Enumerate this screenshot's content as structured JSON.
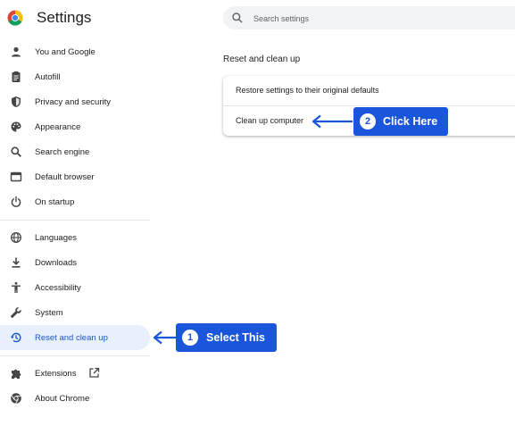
{
  "app": {
    "title": "Settings",
    "logo_icon": "chrome-logo-icon"
  },
  "search": {
    "placeholder": "Search settings",
    "icon": "search-icon"
  },
  "sidebar": {
    "items": [
      {
        "label": "You and Google",
        "icon": "person-icon"
      },
      {
        "label": "Autofill",
        "icon": "clipboard-icon"
      },
      {
        "label": "Privacy and security",
        "icon": "shield-icon"
      },
      {
        "label": "Appearance",
        "icon": "palette-icon"
      },
      {
        "label": "Search engine",
        "icon": "search-icon"
      },
      {
        "label": "Default browser",
        "icon": "browser-window-icon"
      },
      {
        "label": "On startup",
        "icon": "power-icon"
      },
      {
        "label": "Languages",
        "icon": "globe-icon"
      },
      {
        "label": "Downloads",
        "icon": "download-icon"
      },
      {
        "label": "Accessibility",
        "icon": "accessibility-icon"
      },
      {
        "label": "System",
        "icon": "wrench-icon"
      },
      {
        "label": "Reset and clean up",
        "icon": "history-icon",
        "active": true
      },
      {
        "label": "Extensions",
        "icon": "puzzle-icon",
        "trailing_icon": "open-in-new-icon"
      },
      {
        "label": "About Chrome",
        "icon": "chrome-icon"
      }
    ]
  },
  "main": {
    "section_title": "Reset and clean up",
    "rows": [
      {
        "label": "Restore settings to their original defaults"
      },
      {
        "label": "Clean up computer"
      }
    ]
  },
  "annotations": [
    {
      "number": "1",
      "text": "Select This"
    },
    {
      "number": "2",
      "text": "Click Here"
    }
  ],
  "colors": {
    "accent": "#1a56db",
    "active_bg": "#e8f0fe",
    "active_text": "#1a56c9",
    "icon": "#444746"
  }
}
